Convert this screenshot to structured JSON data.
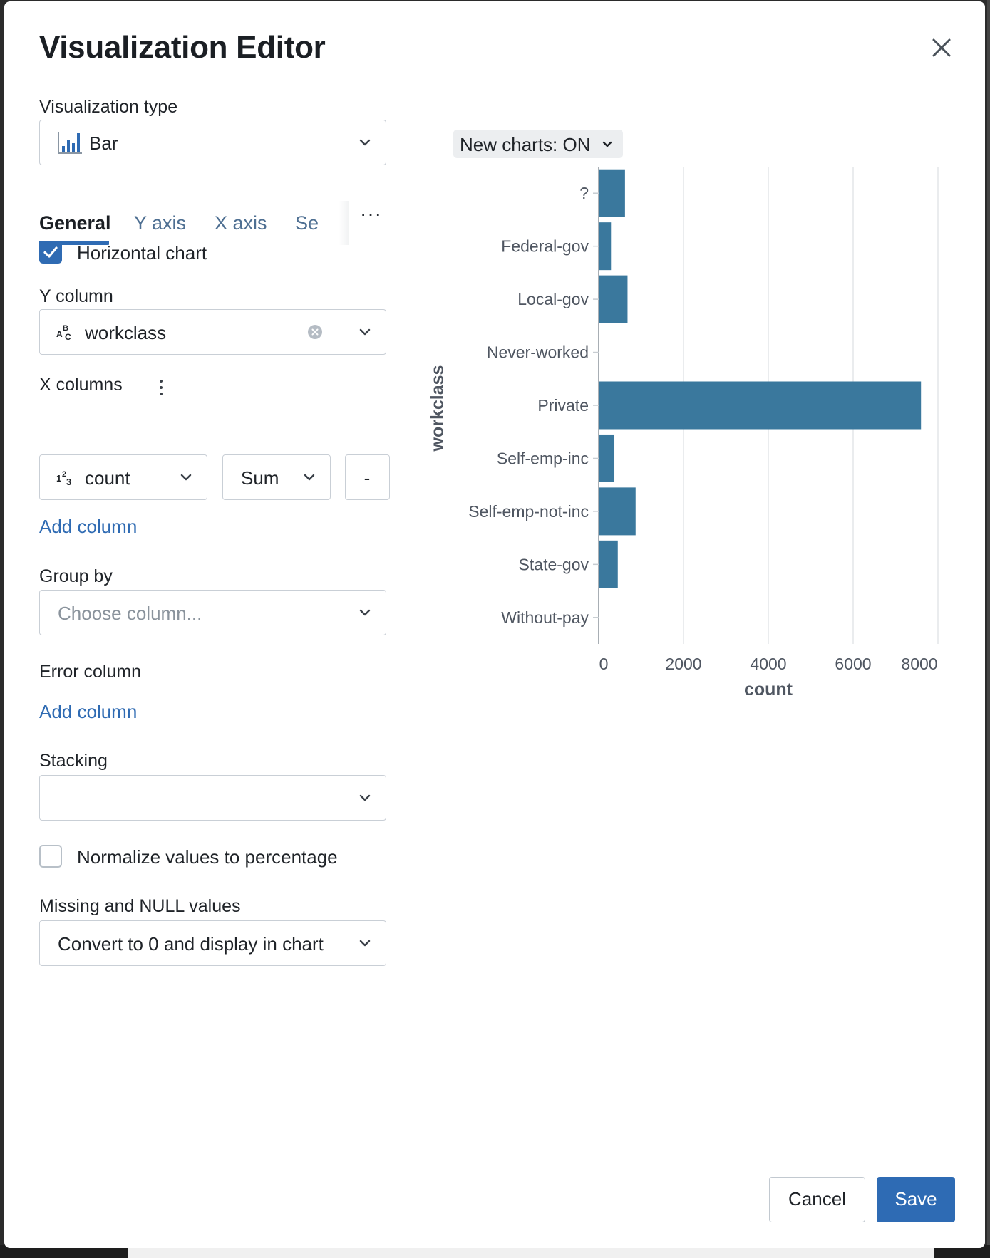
{
  "dialog": {
    "title": "Visualization Editor",
    "close_icon": "close-icon"
  },
  "viz_type": {
    "label": "Visualization type",
    "value": "Bar",
    "icon": "bar-chart-icon"
  },
  "tabs": {
    "items": [
      "General",
      "Y axis",
      "X axis",
      "Se"
    ],
    "active": "General",
    "more": "···"
  },
  "general": {
    "horizontal_chart": {
      "label": "Horizontal chart",
      "checked": true
    },
    "y_column": {
      "label": "Y column",
      "value": "workclass",
      "type_icon": "text-type-icon"
    },
    "x_columns": {
      "label": "X columns",
      "column": "count",
      "type_icon": "number-type-icon",
      "aggregation": "Sum",
      "remove": "-"
    },
    "add_column": "Add column",
    "group_by": {
      "label": "Group by",
      "placeholder": "Choose column..."
    },
    "error_column": {
      "label": "Error column",
      "add": "Add column"
    },
    "stacking": {
      "label": "Stacking",
      "value": ""
    },
    "normalize": {
      "label": "Normalize values to percentage",
      "checked": false
    },
    "missing_null": {
      "label": "Missing and NULL values",
      "value": "Convert to 0 and display in chart"
    }
  },
  "preview": {
    "new_charts_toggle": "New charts: ON"
  },
  "chart_data": {
    "type": "bar",
    "orientation": "horizontal",
    "categories": [
      "?",
      "Federal-gov",
      "Local-gov",
      "Never-worked",
      "Private",
      "Self-emp-inc",
      "Self-emp-not-inc",
      "State-gov",
      "Without-pay"
    ],
    "values": [
      620,
      290,
      680,
      5,
      7600,
      370,
      870,
      450,
      7
    ],
    "xlabel": "count",
    "ylabel": "workclass",
    "xlim": [
      0,
      8000
    ],
    "xticks": [
      0,
      2000,
      4000,
      6000,
      8000
    ],
    "grid": true,
    "bar_color": "#3a789d"
  },
  "footer": {
    "cancel": "Cancel",
    "save": "Save"
  },
  "colors": {
    "accent": "#2e6bb4",
    "link": "#2f6bb3",
    "bar": "#3a789d"
  }
}
